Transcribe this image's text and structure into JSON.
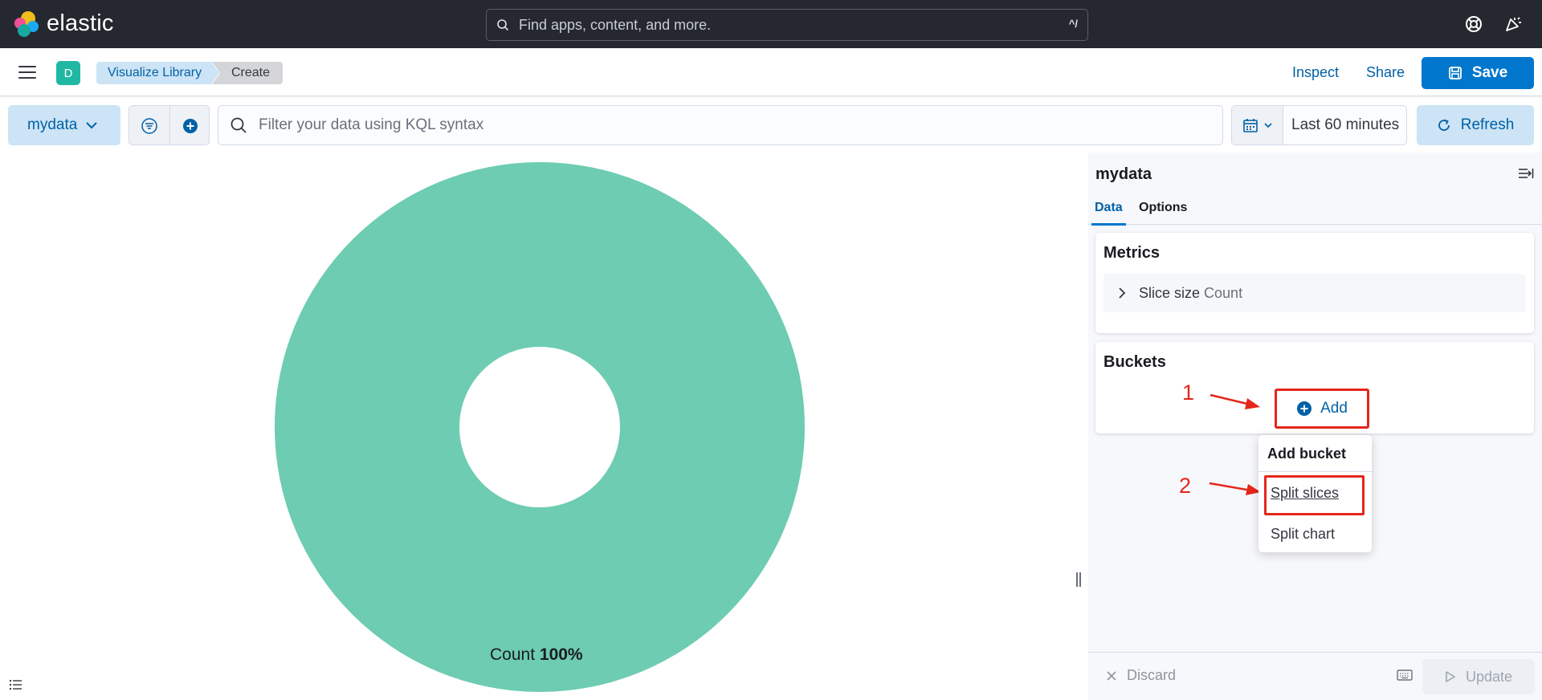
{
  "header": {
    "brand": "elastic",
    "search_placeholder": "Find apps, content, and more.",
    "search_shortcut": "^/"
  },
  "nav": {
    "avatar_letter": "D",
    "breadcrumbs": [
      "Visualize Library",
      "Create"
    ],
    "inspect_label": "Inspect",
    "share_label": "Share",
    "save_label": "Save"
  },
  "query": {
    "data_view": "mydata",
    "kql_placeholder": "Filter your data using KQL syntax",
    "time_range": "Last 60 minutes",
    "refresh_label": "Refresh"
  },
  "chart_data": {
    "type": "pie",
    "donut": true,
    "slices": [
      {
        "label": "Count",
        "value": 100,
        "color": "#6dccb1"
      }
    ],
    "label_prefix": "Count",
    "label_value": "100%"
  },
  "sidebar": {
    "title": "mydata",
    "tabs": [
      {
        "label": "Data",
        "active": true
      },
      {
        "label": "Options",
        "active": false
      }
    ],
    "metrics": {
      "title": "Metrics",
      "row_label": "Slice size",
      "row_value": "Count"
    },
    "buckets": {
      "title": "Buckets",
      "add_label": "Add"
    },
    "popover": {
      "title": "Add bucket",
      "items": [
        "Split slices",
        "Split chart"
      ]
    },
    "annotations": [
      "1",
      "2"
    ],
    "footer": {
      "discard_label": "Discard",
      "update_label": "Update"
    }
  },
  "colors": {
    "accent": "#0077cc",
    "header_bg": "#25282f",
    "highlight_box": "#e5261b",
    "slice": "#6dccb1"
  }
}
